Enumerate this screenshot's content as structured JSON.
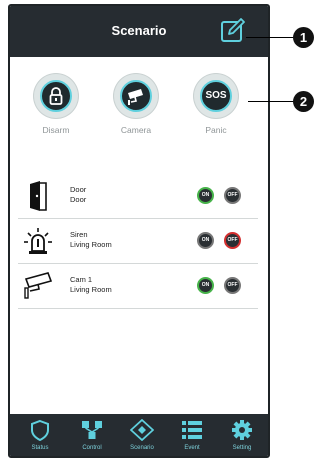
{
  "header": {
    "title": "Scenario"
  },
  "quick_actions": [
    {
      "label": "Disarm",
      "icon": "lock-icon"
    },
    {
      "label": "Camera",
      "icon": "camera-icon"
    },
    {
      "label": "Panic",
      "icon": "sos-icon",
      "text": "SOS"
    }
  ],
  "devices": [
    {
      "name": "Door",
      "location": "Door",
      "icon": "door-icon",
      "on_label": "ON",
      "off_label": "OFF",
      "state": "on"
    },
    {
      "name": "Siren",
      "location": "Living Room",
      "icon": "siren-icon",
      "on_label": "ON",
      "off_label": "OFF",
      "state": "off"
    },
    {
      "name": "Cam 1",
      "location": "Living Room",
      "icon": "cctv-camera-icon",
      "on_label": "ON",
      "off_label": "OFF",
      "state": "on"
    }
  ],
  "tabs": [
    {
      "label": "Status",
      "icon": "shield-icon"
    },
    {
      "label": "Control",
      "icon": "network-icon"
    },
    {
      "label": "Scenario",
      "icon": "diamond-icon"
    },
    {
      "label": "Event",
      "icon": "list-icon"
    },
    {
      "label": "Setting",
      "icon": "gear-icon"
    }
  ],
  "callouts": [
    "1",
    "2"
  ],
  "colors": {
    "header_bg": "#262c31",
    "accent": "#5fd0de",
    "on_ring": "#47b34a",
    "off_ring": "#d32f2f"
  }
}
